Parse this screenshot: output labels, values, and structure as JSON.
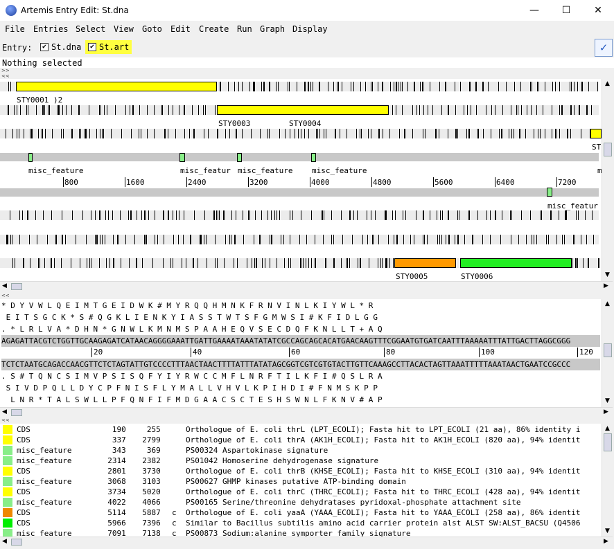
{
  "window": {
    "title": "Artemis Entry Edit: St.dna",
    "minimize": "—",
    "maximize": "☐",
    "close": "✕"
  },
  "menu": [
    "File",
    "Entries",
    "Select",
    "View",
    "Goto",
    "Edit",
    "Create",
    "Run",
    "Graph",
    "Display"
  ],
  "entry_bar": {
    "label": "Entry:",
    "entries": [
      {
        "name": "St.dna",
        "checked": true
      },
      {
        "name": "St.art",
        "checked": true,
        "highlight": "#ffff40"
      }
    ],
    "ok_symbol": "✓"
  },
  "status": "Nothing selected",
  "overview": {
    "labels": [
      "STY0001 )2",
      "STY0003",
      "STY0004",
      "ST",
      "misc_feature",
      "misc_featur",
      "misc_feature",
      "misc_feature",
      "m",
      "misc_featur",
      "STY0005",
      "STY0006"
    ],
    "ruler": [
      "800",
      "1600",
      "2400",
      "3200",
      "4000",
      "4800",
      "5600",
      "6400",
      "7200"
    ]
  },
  "sequence": {
    "rows": [
      "* D Y V W L Q E I M T G E I D W K # M Y R Q Q H M N K F R N V I N L K I Y W L * R",
      " E I T S G C K * S # Q G K L I E N K Y I A S S T W T S F G M W S I # K F I D L G G",
      ". * L R L V A * D H N * G N W L K M N M S P A A H E Q V S E C D Q F K N L L T + A Q",
      "AGAGATTACGTCTGGTTGCAAGAGATCATAACAGGGGAAATTGATTGAAAATAAATATATCGCCAGCAGCACATGAACAAGTTTCGGAATGTGATCAATTTAAAAATTTATTGACTTAGGCGGG",
      "TCTCTAATGCAGACCAACGTTCTCTAGTATTGTCCCCTTTAACTAACTTTTATTTATATAGCGGTCGTCGTGTACTTGTTCAAAGCCTTACACTAGTTAAATTTTTAAATAACTGAATCCGCCC",
      ". S # T Q N C S I M V P S I S Q F Y I Y R W C C M F L N R F T I L K F I # Q S L R A",
      " S I V D P Q L L D Y C P F N I S F L Y M A L L V H V L K P I H D I # F N M S K P P",
      "  L N R * T A L S W L L P F Q N F I F M D G A A C S C T E S H S W N L F K N V # A P"
    ],
    "ruler": [
      "20",
      "40",
      "60",
      "80",
      "100",
      "120"
    ]
  },
  "features": [
    {
      "color": "#ffff00",
      "key": "CDS",
      "start": "190",
      "end": "255",
      "strand": "",
      "note": "Orthologue of E. coli thrL (LPT_ECOLI); Fasta hit to LPT_ECOLI (21 aa), 86% identity i"
    },
    {
      "color": "#ffff00",
      "key": "CDS",
      "start": "337",
      "end": "2799",
      "strand": "",
      "note": "Orthologue of E. coli thrA (AK1H_ECOLI); Fasta hit to AK1H_ECOLI (820 aa), 94% identit"
    },
    {
      "color": "#88ee88",
      "key": "misc_feature",
      "start": "343",
      "end": "369",
      "strand": "",
      "note": "PS00324 Aspartokinase signature"
    },
    {
      "color": "#88ee88",
      "key": "misc_feature",
      "start": "2314",
      "end": "2382",
      "strand": "",
      "note": "PS01042 Homoserine dehydrogenase signature"
    },
    {
      "color": "#ffff00",
      "key": "CDS",
      "start": "2801",
      "end": "3730",
      "strand": "",
      "note": "Orthologue of E. coli thrB (KHSE_ECOLI); Fasta hit to KHSE_ECOLI (310 aa), 94% identit"
    },
    {
      "color": "#88ee88",
      "key": "misc_feature",
      "start": "3068",
      "end": "3103",
      "strand": "",
      "note": "PS00627 GHMP kinases putative ATP-binding domain"
    },
    {
      "color": "#ffff00",
      "key": "CDS",
      "start": "3734",
      "end": "5020",
      "strand": "",
      "note": "Orthologue of E. coli thrC (THRC_ECOLI); Fasta hit to THRC_ECOLI (428 aa), 94% identit"
    },
    {
      "color": "#88ee88",
      "key": "misc_feature",
      "start": "4022",
      "end": "4066",
      "strand": "",
      "note": "PS00165 Serine/threonine dehydratases pyridoxal-phosphate attachment site"
    },
    {
      "color": "#ee8800",
      "key": "CDS",
      "start": "5114",
      "end": "5887",
      "strand": "c",
      "note": "Orthologue of E. coli yaaA (YAAA_ECOLI); Fasta hit to YAAA_ECOLI (258 aa), 86% identit"
    },
    {
      "color": "#00ee00",
      "key": "CDS",
      "start": "5966",
      "end": "7396",
      "strand": "c",
      "note": "Similar to Bacillus subtilis amino acid carrier protein alst ALST SW:ALST_BACSU (Q4506"
    },
    {
      "color": "#88ee88",
      "key": "misc_feature",
      "start": "7091",
      "end": "7138",
      "strand": "c",
      "note": "PS00873 Sodium:alanine symporter family signature"
    }
  ]
}
